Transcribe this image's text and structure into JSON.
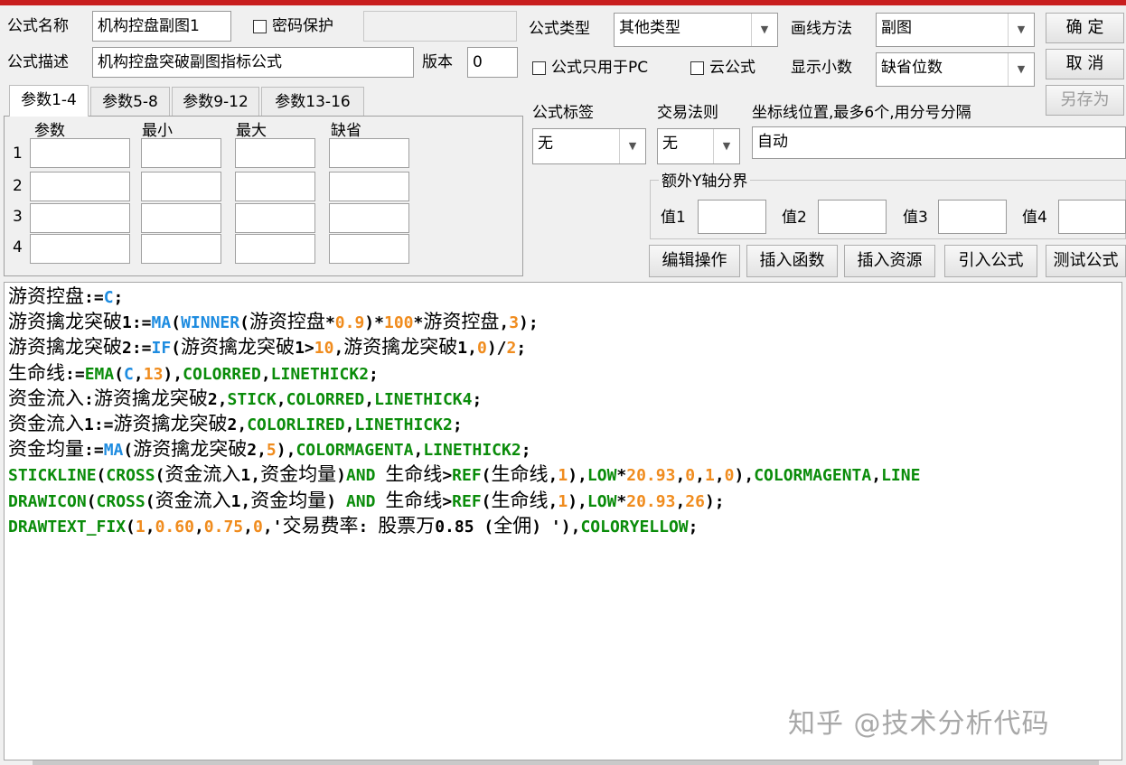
{
  "colors": {
    "accent_bar": "#c81e1e",
    "func_blue": "#1e8ce0",
    "keyword_green": "#0a8c0a",
    "number_orange": "#f08c1e"
  },
  "formula": {
    "name_label": "公式名称",
    "name_value": "机构控盘副图1",
    "password_label": "密码保护",
    "password_value": "",
    "desc_label": "公式描述",
    "desc_value": "机构控盘突破副图指标公式",
    "version_label": "版本",
    "version_value": "0"
  },
  "options": {
    "type_label": "公式类型",
    "type_value": "其他类型",
    "draw_label": "画线方法",
    "draw_value": "副图",
    "pc_only_label": "公式只用于PC",
    "cloud_label": "云公式",
    "decimals_label": "显示小数",
    "decimals_value": "缺省位数",
    "tag_label": "公式标签",
    "tag_value": "无",
    "rule_label": "交易法则",
    "rule_value": "无",
    "axis_label": "坐标线位置,最多6个,用分号分隔",
    "axis_value": "自动",
    "extra_y_label": "额外Y轴分界",
    "y_values": [
      {
        "label": "值1",
        "value": ""
      },
      {
        "label": "值2",
        "value": ""
      },
      {
        "label": "值3",
        "value": ""
      },
      {
        "label": "值4",
        "value": ""
      }
    ]
  },
  "buttons": {
    "ok": "确 定",
    "cancel": "取 消",
    "save_as": "另存为"
  },
  "params": {
    "tabs": [
      "参数1-4",
      "参数5-8",
      "参数9-12",
      "参数13-16"
    ],
    "headers": [
      "参数",
      "最小",
      "最大",
      "缺省"
    ],
    "rows": [
      "1",
      "2",
      "3",
      "4"
    ]
  },
  "actions": [
    "编辑操作",
    "插入函数",
    "插入资源",
    "引入公式",
    "测试公式"
  ],
  "editor_lines": [
    "游资控盘:=C;",
    "游资擒龙突破1:=MA(WINNER(游资控盘*0.9)*100*游资控盘,3);",
    "游资擒龙突破2:=IF(游资擒龙突破1>10,游资擒龙突破1,0)/2;",
    "生命线:=EMA(C,13),COLORRED,LINETHICK2;",
    "资金流入:游资擒龙突破2,STICK,COLORRED,LINETHICK4;",
    "资金流入1:=游资擒龙突破2,COLORLIRED,LINETHICK2;",
    "资金均量:=MA(游资擒龙突破2,5),COLORMAGENTA,LINETHICK2;",
    "STICKLINE(CROSS(资金流入1,资金均量)AND 生命线>REF(生命线,1),LOW*20.93,0,1,0),COLORMAGENTA,LINE",
    "DRAWICON(CROSS(资金流入1,资金均量) AND 生命线>REF(生命线,1),LOW*20.93,26);",
    "DRAWTEXT_FIX(1,0.60,0.75,0,'交易费率: 股票万0.85 (全佣) '),COLORYELLOW;"
  ],
  "watermark": "知乎 @技术分析代码"
}
